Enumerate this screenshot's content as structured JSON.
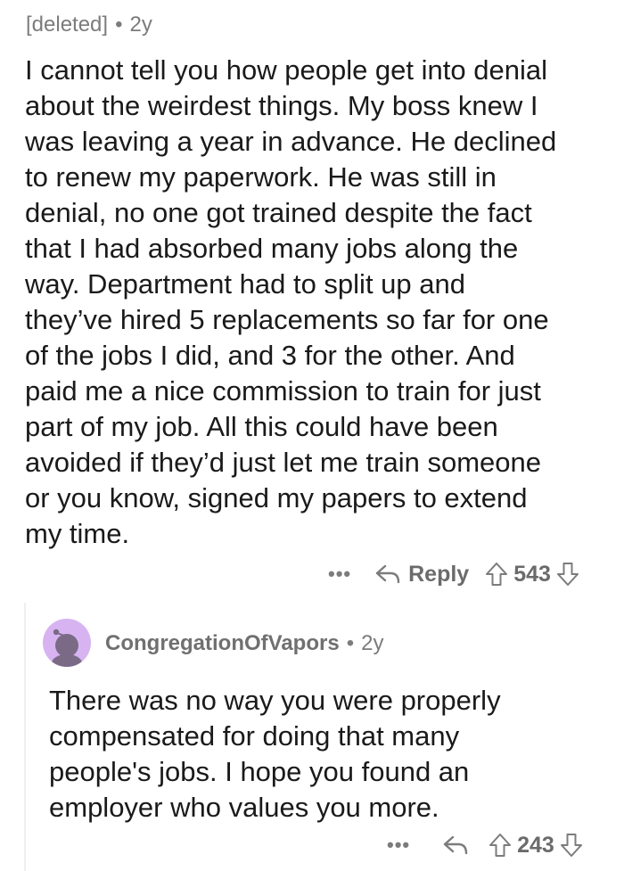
{
  "parent": {
    "author": "[deleted]",
    "age": "2y",
    "separator": "•",
    "lines": [
      "I cannot tell you how people get into denial",
      "about the weirdest things. My boss knew I",
      "was leaving a year in advance. He declined",
      "to renew my paperwork. He was still in",
      "denial, no one got trained despite the fact",
      "that I had absorbed many jobs along the",
      "way. Department had to split up and",
      "they’ve hired 5 replacements so far for one",
      "of the jobs I did, and 3 for the other. And",
      "paid me a nice commission to train for just",
      "part of my job. All this could have been",
      "avoided if they’d just let me train someone",
      "or you know, signed my papers to extend",
      "my time."
    ],
    "more_label": "•••",
    "reply_label": "Reply",
    "score": "543"
  },
  "child": {
    "author": "CongregationOfVapors",
    "age": "2y",
    "separator": "•",
    "lines": [
      "There was no way you were properly",
      "compensated for doing that many",
      "people's jobs. I hope you found an",
      "employer who values you more."
    ],
    "more_label": "•••",
    "score": "243"
  },
  "icons": {
    "reply": "reply-arrow-icon",
    "upvote": "upvote-arrow-icon",
    "downvote": "downvote-arrow-icon",
    "avatar": "snoo-avatar-icon"
  },
  "colors": {
    "meta_text": "#7c7c7c",
    "body_text": "#1a1a1b",
    "avatar_bg": "#d7b4f1",
    "thread_line": "#edeff1"
  }
}
